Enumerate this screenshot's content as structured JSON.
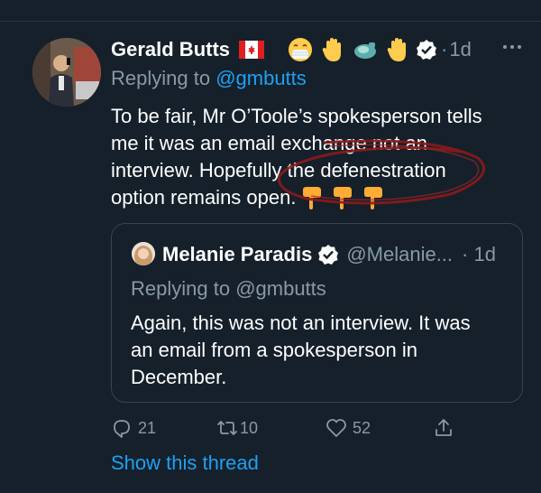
{
  "tweet": {
    "author_name": "Gerald Butts",
    "flag_emoji": "canadian-flag",
    "emojis": [
      "mask-face-emoji",
      "raised-hand-emoji",
      "tea-emoji",
      "raised-hand-emoji"
    ],
    "separator": "·",
    "time": "1d",
    "replying_prefix": "Replying to ",
    "replying_handle": "@gmbutts",
    "text_lines": [
      "To be fair, Mr O’Toole’s spokesperson tells",
      "me it was an email exchange not an",
      "interview. Hopefully the defenestration",
      "option remains open."
    ],
    "trailing_emoji": "pointing-down-emoji"
  },
  "quote": {
    "author_name": "Melanie Paradis",
    "handle": "@Melanie...",
    "time": "· 1d",
    "replying_prefix": "Replying to ",
    "replying_handle": "@gmbutts",
    "text_lines": [
      "Again, this was not an interview. It was",
      "an email from a spokesperson in",
      "December."
    ]
  },
  "actions": {
    "replies": "21",
    "retweets": "10",
    "likes": "52"
  },
  "show_thread": "Show this thread",
  "colors": {
    "background": "#15202b",
    "secondary_text": "#8899a6",
    "link": "#1da1f2",
    "border": "#38444d",
    "annotation": "#8b1a1a"
  }
}
